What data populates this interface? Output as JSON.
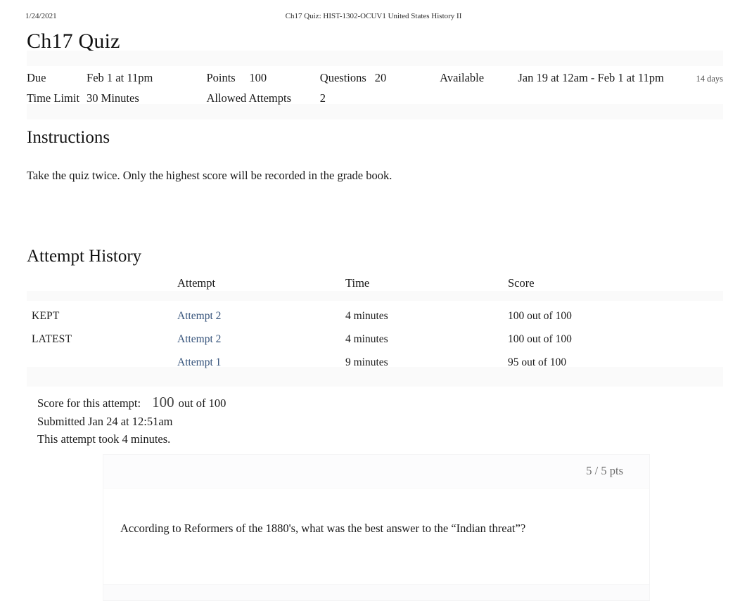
{
  "print_header": {
    "date": "1/24/2021",
    "document_title": "Ch17 Quiz: HIST-1302-OCUV1 United States History II"
  },
  "page_title": "Ch17 Quiz",
  "quiz_meta": {
    "due_label": "Due",
    "due_value": "Feb 1 at 11pm",
    "points_label": "Points",
    "points_value": "100",
    "questions_label": "Questions",
    "questions_value": "20",
    "available_label": "Available",
    "available_value": "Jan 19 at 12am - Feb 1 at 11pm",
    "available_duration": "14 days",
    "time_limit_label": "Time Limit",
    "time_limit_value": "30 Minutes",
    "allowed_attempts_label": "Allowed Attempts",
    "allowed_attempts_value": "2"
  },
  "instructions": {
    "heading": "Instructions",
    "body": "Take the quiz twice. Only the highest score will be recorded in the grade book."
  },
  "attempt_history": {
    "heading": "Attempt History",
    "columns": {
      "status": "",
      "attempt": "Attempt",
      "time": "Time",
      "score": "Score"
    },
    "rows": [
      {
        "status": "KEPT",
        "attempt": "Attempt 2",
        "time": "4 minutes",
        "score": "100 out of 100"
      },
      {
        "status": "LATEST",
        "attempt": "Attempt 2",
        "time": "4 minutes",
        "score": "100 out of 100"
      },
      {
        "status": "",
        "attempt": "Attempt 1",
        "time": "9 minutes",
        "score": "95 out of 100"
      }
    ]
  },
  "score_summary": {
    "score_label": "Score for this attempt:",
    "score_value": "100",
    "score_out_of": "out of 100",
    "submitted": "Submitted Jan 24 at 12:51am",
    "duration": "This attempt took 4 minutes."
  },
  "question": {
    "points": "5 / 5 pts",
    "text": "According to Reformers of the 1880's, what was the best answer to the “Indian threat”?"
  },
  "colors": {
    "link": "#34527a",
    "muted": "#6b6b6b",
    "band": "#fafafa"
  }
}
